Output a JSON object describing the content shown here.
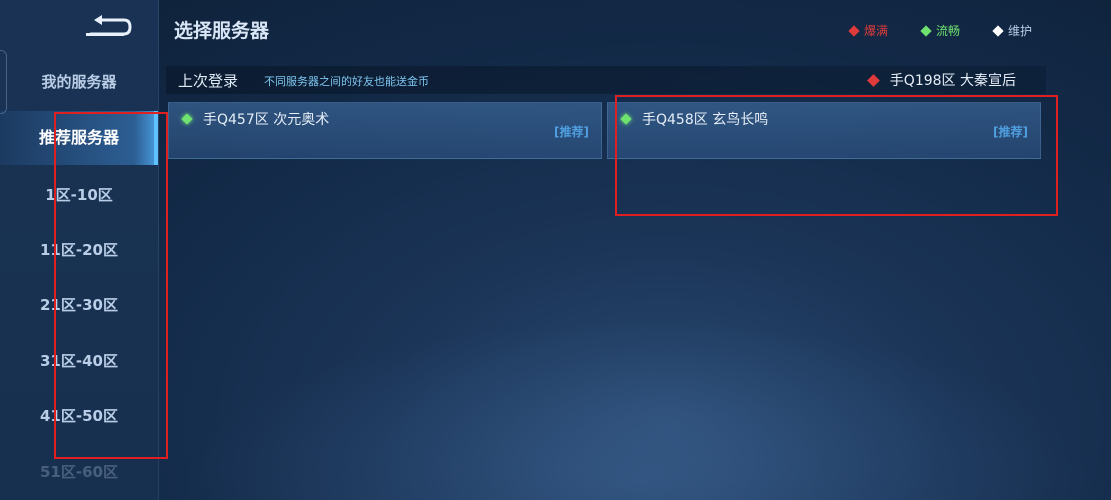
{
  "header": {
    "title": "选择服务器"
  },
  "legend": [
    {
      "label": "爆满",
      "color": "#e03a3a"
    },
    {
      "label": "流畅",
      "color": "#6fe26f"
    },
    {
      "label": "维护",
      "color": "#ffffff"
    }
  ],
  "sidebar": {
    "items": [
      {
        "label": "我的服务器"
      },
      {
        "label": "推荐服务器"
      },
      {
        "label": "1区-10区"
      },
      {
        "label": "11区-20区"
      },
      {
        "label": "21区-30区"
      },
      {
        "label": "31区-40区"
      },
      {
        "label": "41区-50区"
      },
      {
        "label": "51区-60区"
      }
    ]
  },
  "last_login": {
    "title": "上次登录",
    "hint": "不同服务器之间的好友也能送金币",
    "server": "手Q198区 大秦宣后",
    "status_color": "#e03a3a"
  },
  "servers": [
    {
      "name": "手Q457区 次元奥术",
      "tag": "[推荐]",
      "status_color": "#6fe26f"
    },
    {
      "name": "手Q458区 玄鸟长鸣",
      "tag": "[推荐]",
      "status_color": "#6fe26f"
    }
  ]
}
